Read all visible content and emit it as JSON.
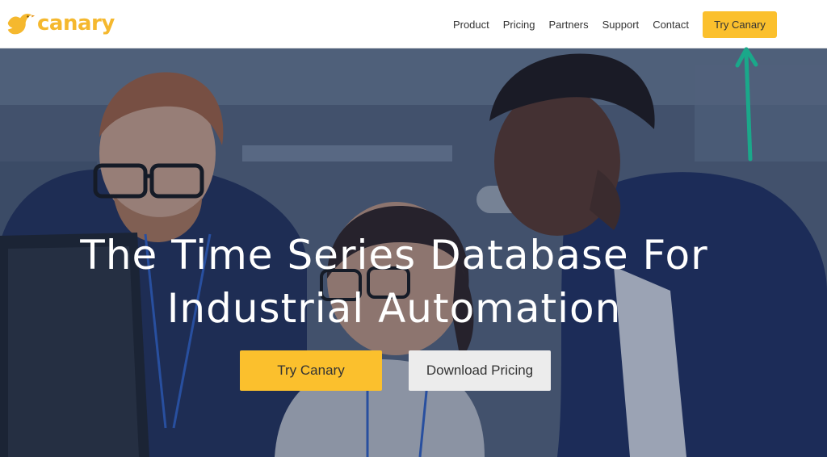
{
  "brand": {
    "name": "canary",
    "logo_icon": "bird-icon",
    "color": "#f5b82e"
  },
  "nav": {
    "links": [
      "Product",
      "Pricing",
      "Partners",
      "Support",
      "Contact"
    ],
    "cta_label": "Try Canary"
  },
  "hero": {
    "headline_line1": "The Time Series Database For",
    "headline_line2": "Industrial Automation",
    "primary_button": "Try Canary",
    "secondary_button": "Download Pricing"
  },
  "annotation": {
    "icon": "arrow-up-icon",
    "color": "#1aa88a"
  },
  "colors": {
    "accent": "#fbc02d",
    "secondary_button_bg": "#ececec"
  }
}
